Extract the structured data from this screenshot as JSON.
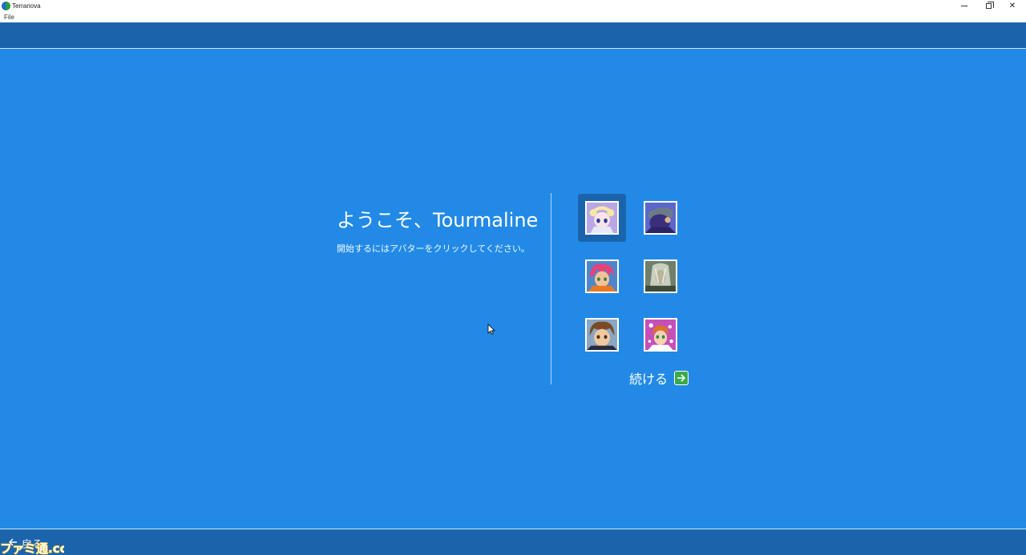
{
  "window": {
    "title": "Terranova",
    "minimize_icon": "minimize-icon",
    "maximize_icon": "restore-icon",
    "close_icon": "close-icon",
    "close_glyph": "✕"
  },
  "menu": {
    "file_label": "File"
  },
  "welcome": {
    "title": "ようこそ、Tourmaline",
    "subtitle": "開始するにはアバターをクリックしてください。"
  },
  "avatars": [
    {
      "name": "avatar-1",
      "selected": true
    },
    {
      "name": "avatar-2",
      "selected": false
    },
    {
      "name": "avatar-3",
      "selected": false
    },
    {
      "name": "avatar-4",
      "selected": false
    },
    {
      "name": "avatar-5",
      "selected": false
    },
    {
      "name": "avatar-6",
      "selected": false
    }
  ],
  "continue": {
    "label": "続ける",
    "icon": "arrow-right-icon"
  },
  "footer": {
    "back_label": "戻る",
    "back_icon": "arrow-left-icon"
  },
  "watermark": {
    "text": "ファミ通.com"
  },
  "colors": {
    "background": "#228ae6",
    "band": "#1b64ac",
    "continue_icon": "#3aa94a"
  }
}
